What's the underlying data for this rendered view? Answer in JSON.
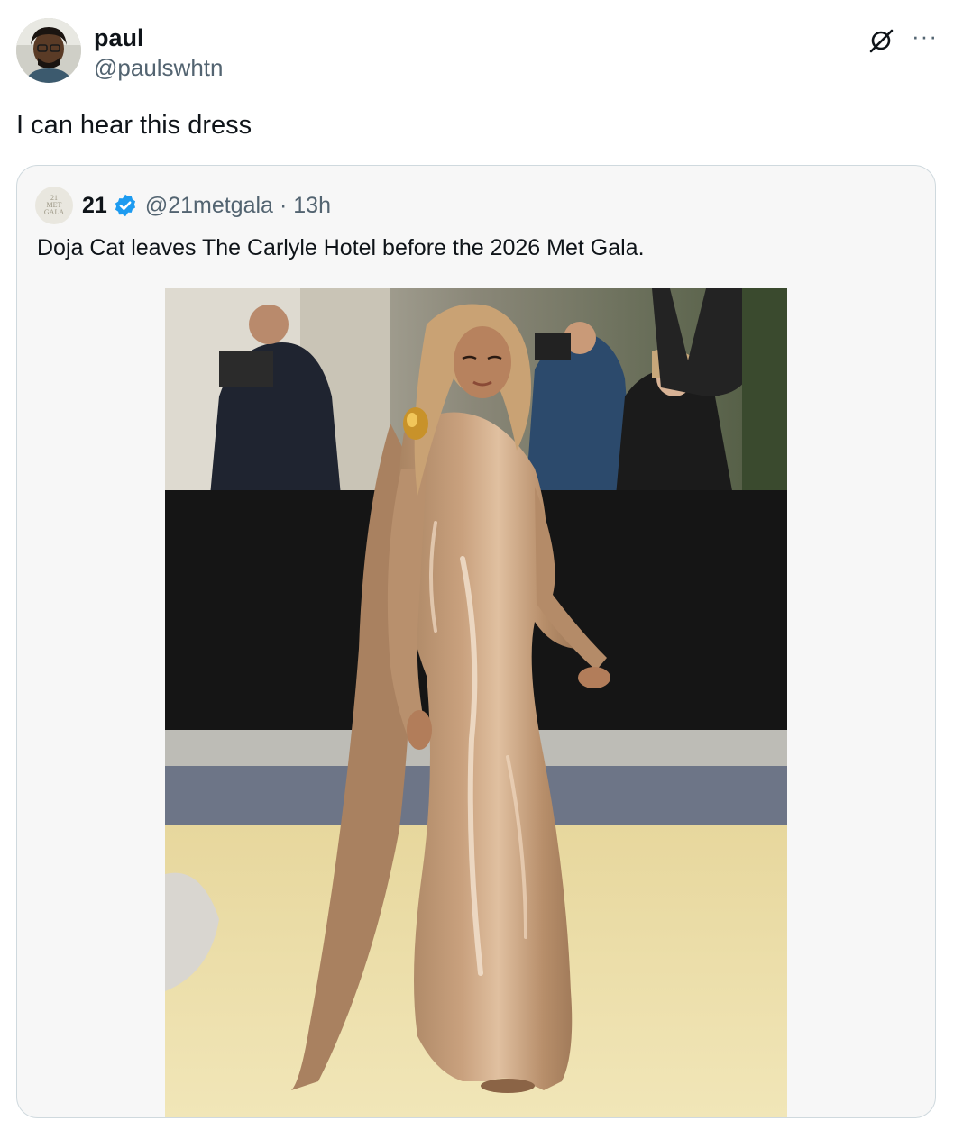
{
  "tweet": {
    "display_name": "paul",
    "handle": "@paulswhtn",
    "text": "I can hear this dress",
    "avatar_icon": "user-avatar",
    "actions": {
      "grok_icon": "grok-slash-circle-icon",
      "more_icon": "more-horizontal-icon",
      "more_label": "···"
    }
  },
  "quote": {
    "avatar_lines": [
      "21",
      "MET",
      "GALA"
    ],
    "display_name": "21",
    "verified": true,
    "verified_color": "#1d9bf0",
    "handle": "@21metgala",
    "separator": "·",
    "time": "13h",
    "text": "Doja Cat leaves The Carlyle Hotel before the 2026 Met Gala.",
    "image_description_icon": "met-gala-red-carpet-photo"
  },
  "colors": {
    "text_primary": "#0f1419",
    "text_secondary": "#536471",
    "border": "#cfd9de",
    "quote_bg": "#f7f7f7"
  }
}
